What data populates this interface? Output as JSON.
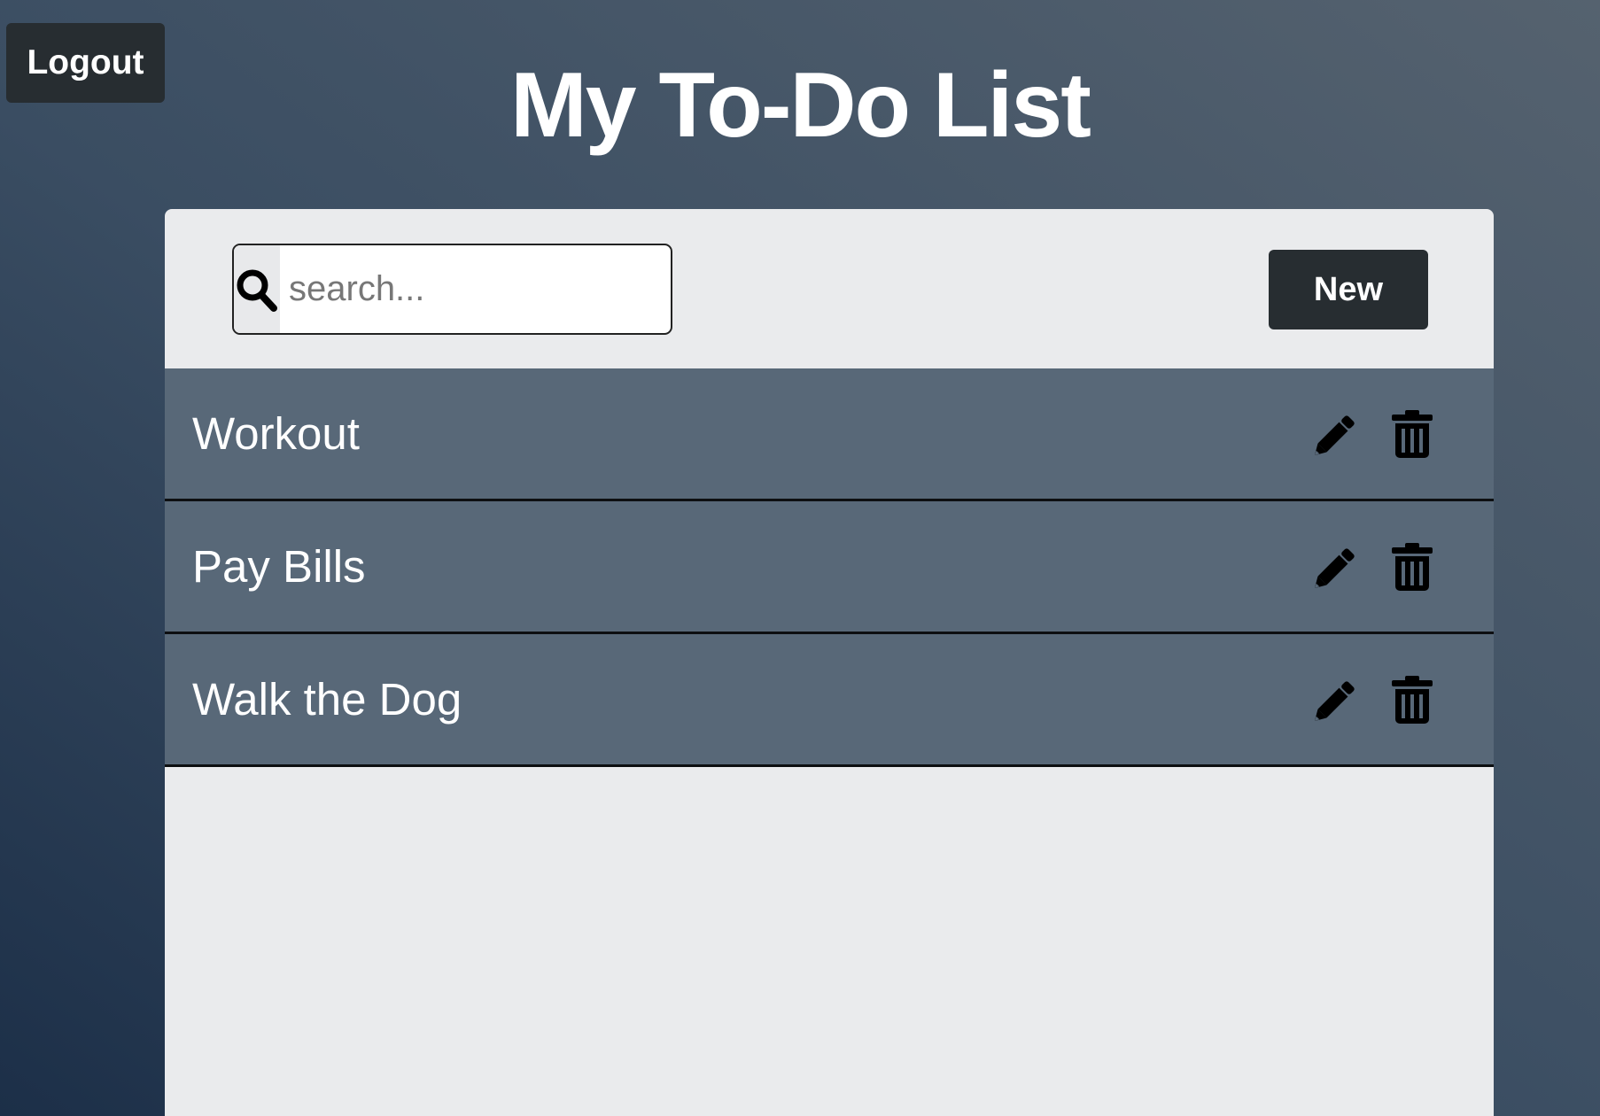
{
  "header": {
    "logout_label": "Logout",
    "title": "My To-Do List"
  },
  "toolbar": {
    "search": {
      "icon": "search-icon",
      "placeholder": "search...",
      "value": ""
    },
    "new_label": "New"
  },
  "todos": [
    {
      "label": "Workout",
      "edit_icon": "pencil-icon",
      "delete_icon": "trash-icon"
    },
    {
      "label": "Pay Bills",
      "edit_icon": "pencil-icon",
      "delete_icon": "trash-icon"
    },
    {
      "label": "Walk the Dog",
      "edit_icon": "pencil-icon",
      "delete_icon": "trash-icon"
    }
  ],
  "colors": {
    "background_dark": "#1c2f48",
    "background_light": "#55626f",
    "panel": "#eaebed",
    "row": "#586878",
    "button": "#272d31",
    "text_light": "#ffffff"
  }
}
